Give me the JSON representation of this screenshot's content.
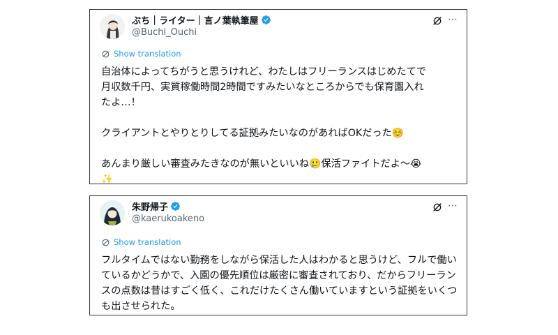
{
  "tweets": [
    {
      "display_name": "ぶち｜ライター｜言ノ葉執筆屋",
      "handle": "@Buchi_Ouchi",
      "translate_label": "Show translation",
      "text_lines": [
        "自治体によってちがうと思うけれど、わたしはフリーランスはじめたてで",
        "月収数千円、実質稼働時間2時間ですみたいなところからでも保育園入れ",
        "たよ…！",
        "",
        "クライアントとやりとりしてる証拠みたいなのがあればOKだった",
        "",
        "あんまり厳しい審査みたきなのが無いといいね",
        ""
      ],
      "line_emojis": {
        "4": "☺️",
        "6": "🥲",
        "7": "✨"
      },
      "line6_suffix": "保活ファイトだよ〜",
      "line6_end_emoji": "😭"
    },
    {
      "display_name": "朱野帰子",
      "handle": "@kaerukoakeno",
      "translate_label": "Show translation",
      "text": "フルタイムではない勤務をしながら保活した人はわかると思うけど、フルで働いているかどうかで、入園の優先順位は厳密に審査されており、だからフリーランスの点数は昔はすごく低く、これだけたくさん働いていますという証拠をいくつも出させられた。"
    }
  ],
  "colors": {
    "link": "#1d9bf0",
    "verified": "#1d9bf0",
    "muted": "#536471"
  },
  "icons": [
    "avatar",
    "verified-badge-icon",
    "grok-icon",
    "more-options-icon",
    "translate-icon"
  ]
}
